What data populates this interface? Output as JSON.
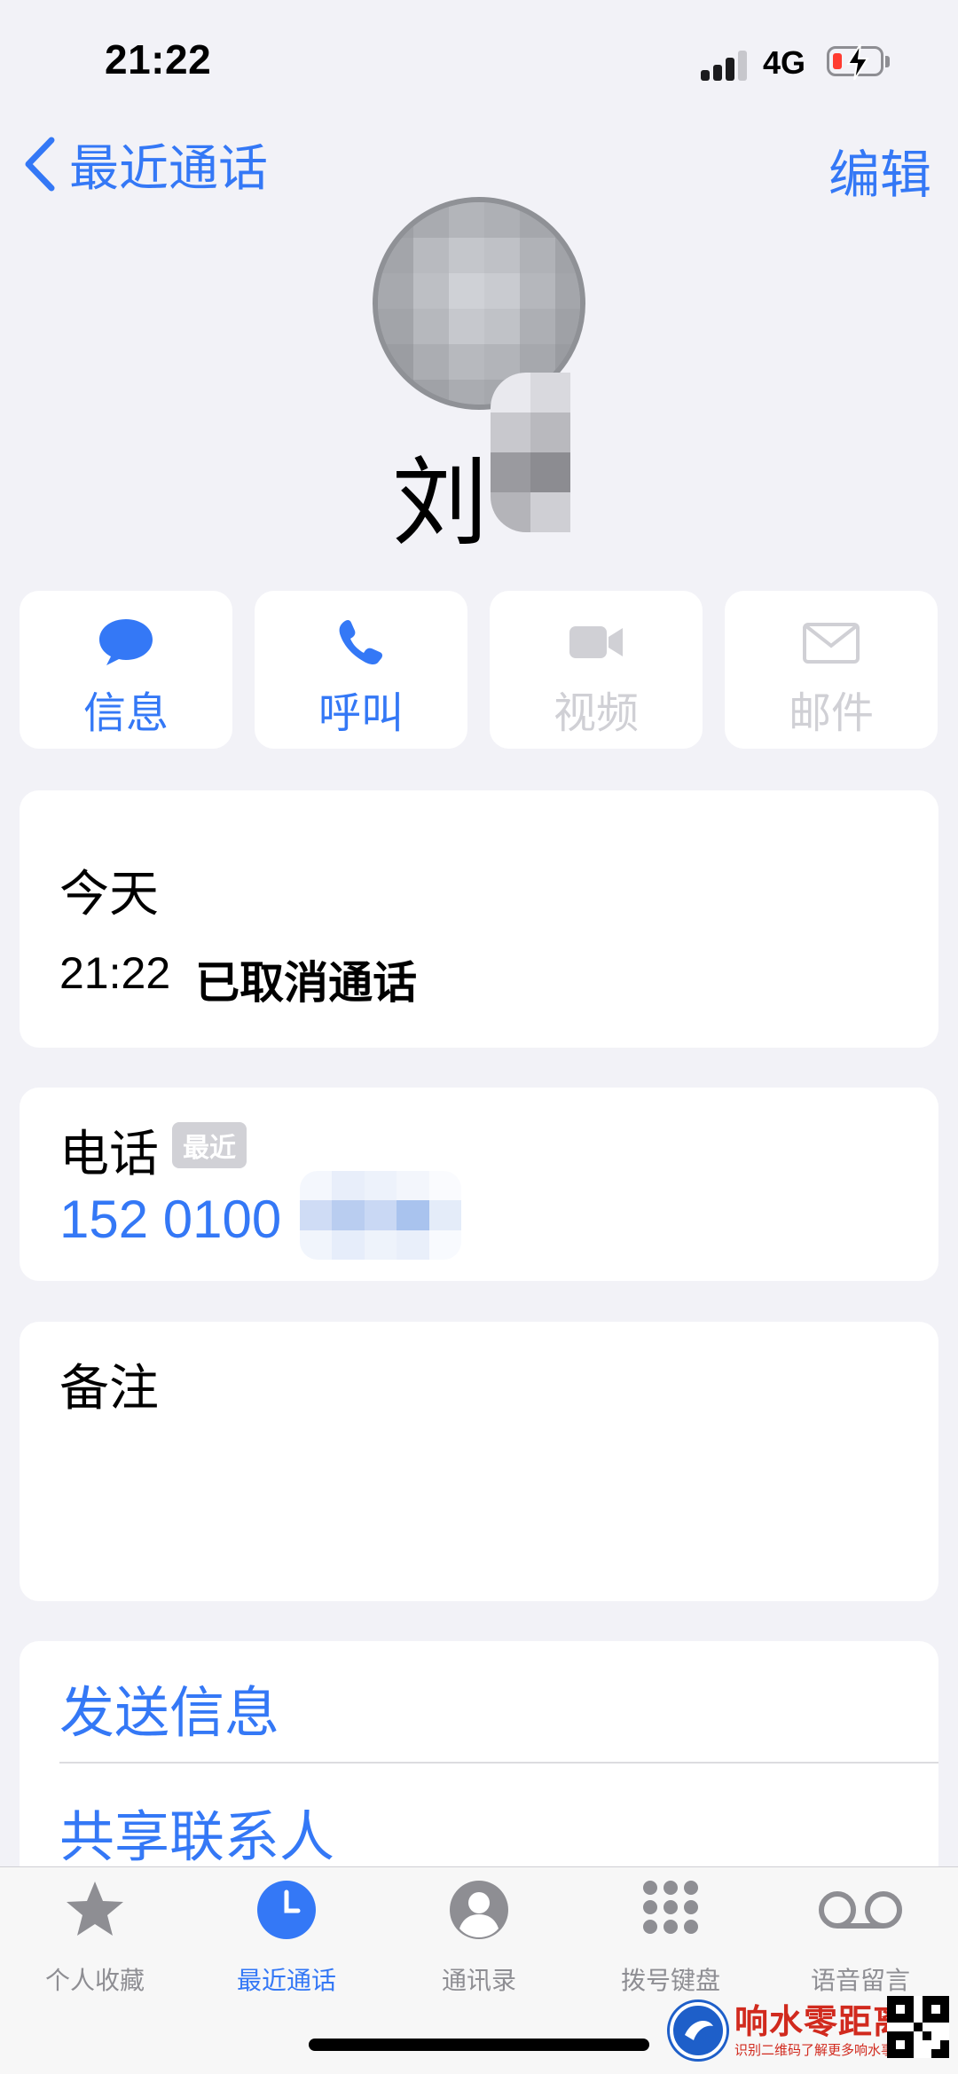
{
  "status_bar": {
    "time": "21:22",
    "network": "4G"
  },
  "nav": {
    "back_label": "最近通话",
    "edit_label": "编辑"
  },
  "contact": {
    "name_visible": "刘"
  },
  "actions": [
    {
      "label": "信息",
      "icon": "message-bubble-icon",
      "enabled": true
    },
    {
      "label": "呼叫",
      "icon": "phone-icon",
      "enabled": true
    },
    {
      "label": "视频",
      "icon": "video-camera-icon",
      "enabled": false
    },
    {
      "label": "邮件",
      "icon": "mail-envelope-icon",
      "enabled": false
    }
  ],
  "call_history": {
    "day": "今天",
    "time": "21:22",
    "status": "已取消通话"
  },
  "phone": {
    "label": "电话",
    "badge": "最近",
    "number_visible": "152 0100"
  },
  "notes": {
    "label": "备注"
  },
  "links": {
    "send_message": "发送信息",
    "share_contact": "共享联系人"
  },
  "tab_bar": [
    {
      "label": "个人收藏",
      "icon": "star-icon",
      "active": false
    },
    {
      "label": "最近通话",
      "icon": "clock-icon",
      "active": true
    },
    {
      "label": "通讯录",
      "icon": "person-circle-icon",
      "active": false
    },
    {
      "label": "拨号键盘",
      "icon": "keypad-icon",
      "active": false
    },
    {
      "label": "语音留言",
      "icon": "voicemail-icon",
      "active": false
    }
  ],
  "watermark": {
    "title": "响水零距离",
    "subtitle": "识别二维码了解更多响水事"
  },
  "colors": {
    "accent": "#3478F6",
    "background": "#F2F2F7",
    "card": "#FFFFFF",
    "disabled": "#D0D0D5"
  }
}
